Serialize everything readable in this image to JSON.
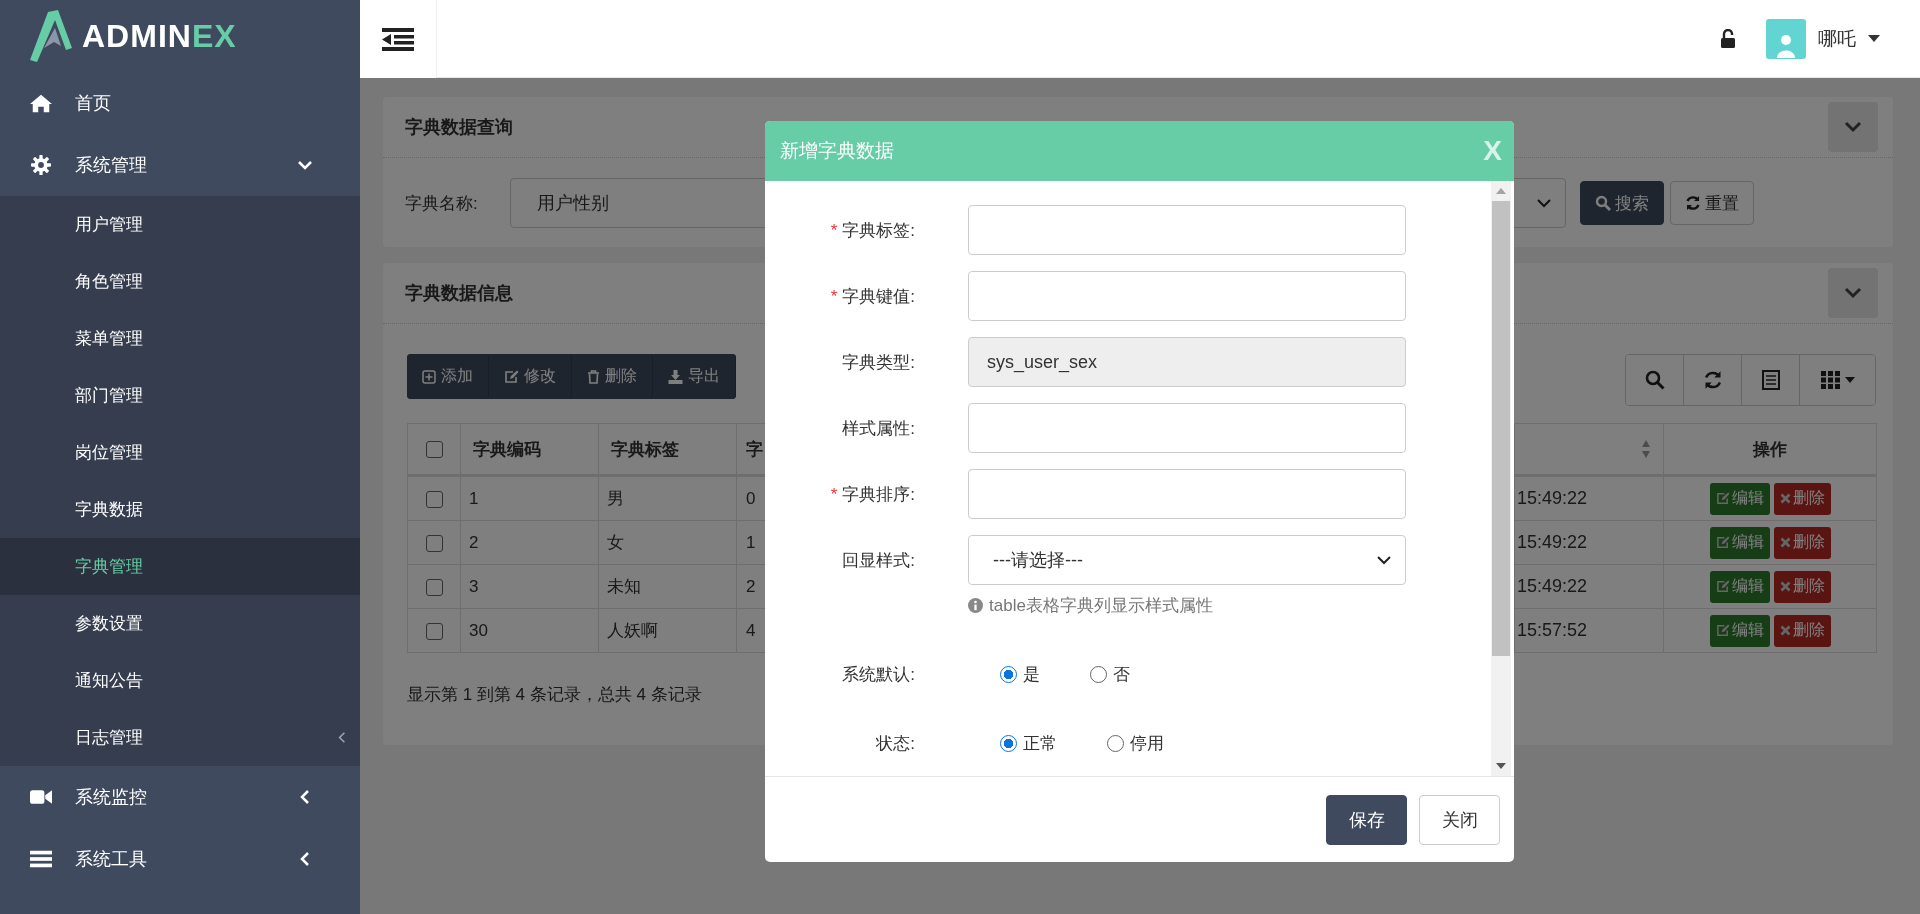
{
  "logo": {
    "text_a": "ADMIN",
    "text_b": "EX"
  },
  "sidebar": {
    "items": [
      {
        "label": "首页",
        "selected": false
      },
      {
        "label": "系统管理",
        "selected": false,
        "expanded": true,
        "children": [
          {
            "label": "用户管理",
            "selected": false
          },
          {
            "label": "角色管理",
            "selected": false
          },
          {
            "label": "菜单管理",
            "selected": false
          },
          {
            "label": "部门管理",
            "selected": false
          },
          {
            "label": "岗位管理",
            "selected": false
          },
          {
            "label": "字典数据",
            "selected": false
          },
          {
            "label": "字典管理",
            "selected": true
          },
          {
            "label": "参数设置",
            "selected": false
          },
          {
            "label": "通知公告",
            "selected": false
          },
          {
            "label": "日志管理",
            "selected": false,
            "expanded": false
          }
        ]
      },
      {
        "label": "系统监控",
        "selected": false,
        "expanded": false
      },
      {
        "label": "系统工具",
        "selected": false,
        "expanded": false
      }
    ]
  },
  "header": {
    "user": "哪吒"
  },
  "query_panel": {
    "title": "字典数据查询",
    "field_label": "字典名称:",
    "field_value": "用户性别",
    "search_button": "搜索",
    "reset_button": "重置"
  },
  "data_panel": {
    "title": "字典数据信息",
    "toolbar": [
      "添加",
      "修改",
      "删除",
      "导出"
    ],
    "table": {
      "header_checked": false,
      "columns": [
        "字典编码",
        "字典标签",
        "字"
      ],
      "action_column": "操作",
      "rows": [
        {
          "checked": false,
          "cells": [
            "1",
            "男",
            "0"
          ],
          "time": "15:49:22",
          "actions": [
            "编辑",
            "删除"
          ]
        },
        {
          "checked": false,
          "cells": [
            "2",
            "女",
            "1"
          ],
          "time": "15:49:22",
          "actions": [
            "编辑",
            "删除"
          ]
        },
        {
          "checked": false,
          "cells": [
            "3",
            "未知",
            "2"
          ],
          "time": "15:49:22",
          "actions": [
            "编辑",
            "删除"
          ]
        },
        {
          "checked": false,
          "cells": [
            "30",
            "人妖啊",
            "4"
          ],
          "time": "15:57:52",
          "actions": [
            "编辑",
            "删除"
          ]
        }
      ]
    },
    "pagination": "显示第 1 到第 4 条记录，总共 4 条记录"
  },
  "dialog": {
    "title": "新增字典数据",
    "close": "X",
    "required_mark": "*",
    "fields": [
      {
        "kind": "text",
        "label": "字典标签:",
        "required": true
      },
      {
        "kind": "text",
        "label": "字典键值:",
        "required": true
      },
      {
        "kind": "readonly",
        "label": "字典类型:",
        "required": false,
        "value": "sys_user_sex"
      },
      {
        "kind": "text",
        "label": "样式属性:",
        "required": false
      },
      {
        "kind": "text",
        "label": "字典排序:",
        "required": true
      },
      {
        "kind": "select",
        "label": "回显样式:",
        "required": false,
        "value": "---请选择---",
        "hint": "table表格字典列显示样式属性"
      }
    ],
    "radio_groups": [
      {
        "label": "系统默认:",
        "options": [
          {
            "label": "是",
            "selected": true
          },
          {
            "label": "否",
            "selected": false
          }
        ]
      },
      {
        "label": "状态:",
        "options": [
          {
            "label": "正常",
            "selected": true
          },
          {
            "label": "停用",
            "selected": false
          }
        ]
      }
    ],
    "buttons": [
      "保存",
      "关闭"
    ]
  }
}
